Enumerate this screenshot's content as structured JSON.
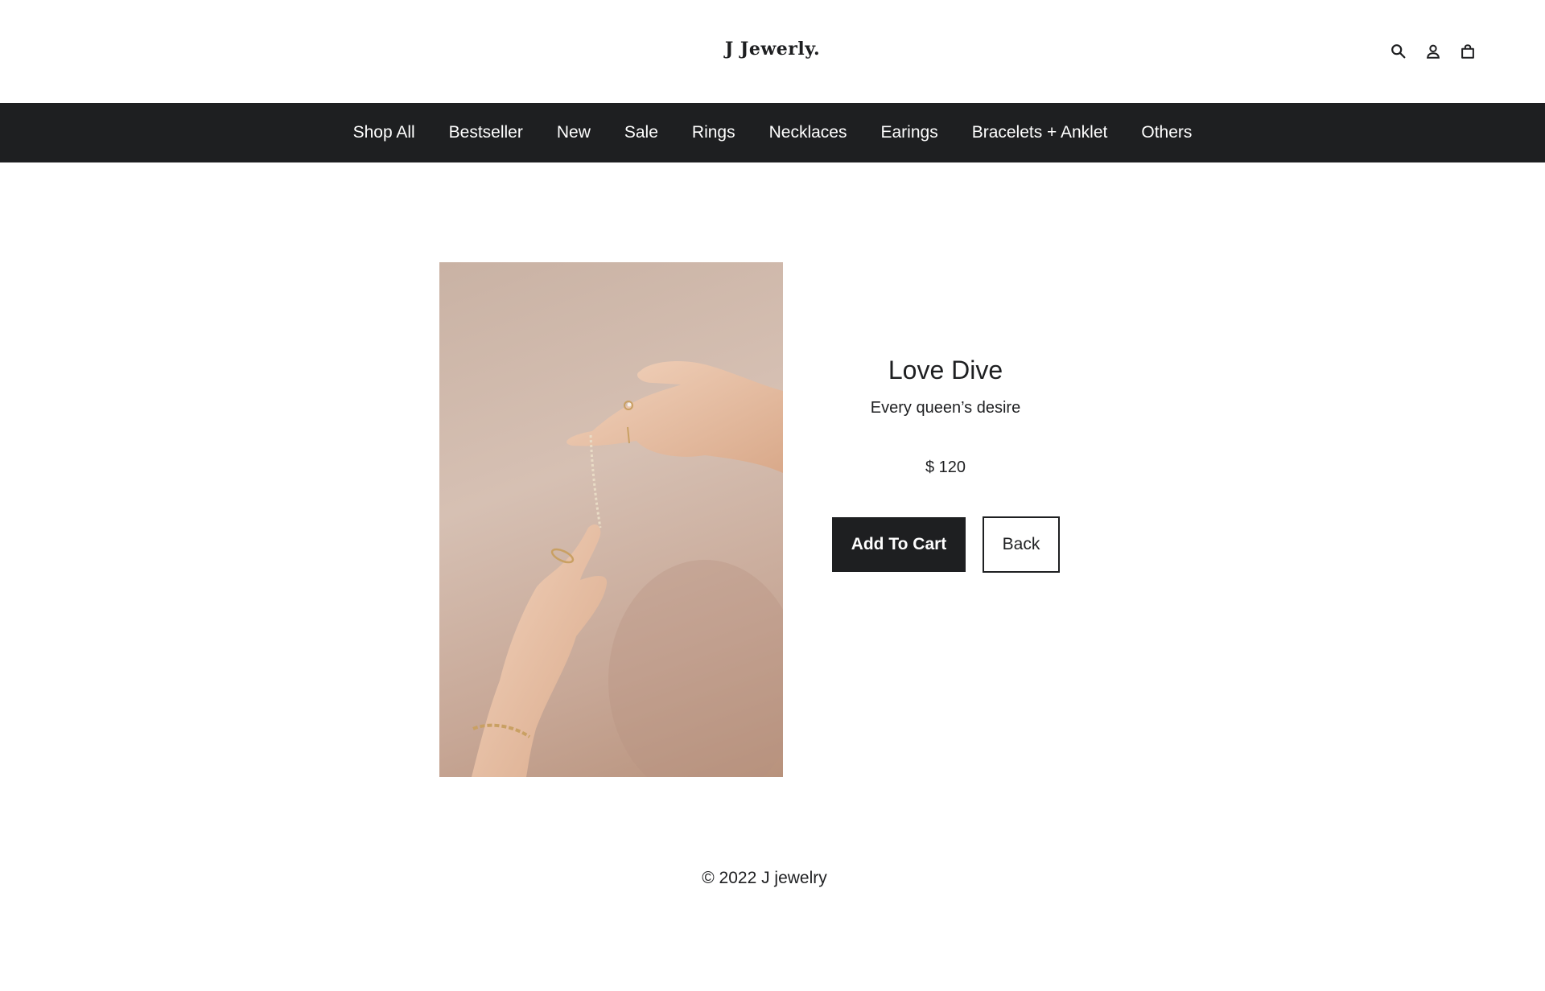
{
  "header": {
    "logo": "J Jewerly.",
    "icons": [
      "search-icon",
      "user-icon",
      "cart-icon"
    ]
  },
  "nav": {
    "items": [
      {
        "label": "Shop All"
      },
      {
        "label": "Bestseller"
      },
      {
        "label": "New"
      },
      {
        "label": "Sale"
      },
      {
        "label": "Rings"
      },
      {
        "label": "Necklaces"
      },
      {
        "label": "Earings"
      },
      {
        "label": "Bracelets + Anklet"
      },
      {
        "label": "Others"
      }
    ]
  },
  "product": {
    "title": "Love Dive",
    "subtitle": "Every queen’s desire",
    "price": "$ 120",
    "add_to_cart_label": "Add To Cart",
    "back_label": "Back"
  },
  "footer": {
    "copyright": "© 2022 J jewelry"
  },
  "colors": {
    "primary": "#1e1f21",
    "background": "#ffffff",
    "image_tone": "#c9b2a4"
  }
}
